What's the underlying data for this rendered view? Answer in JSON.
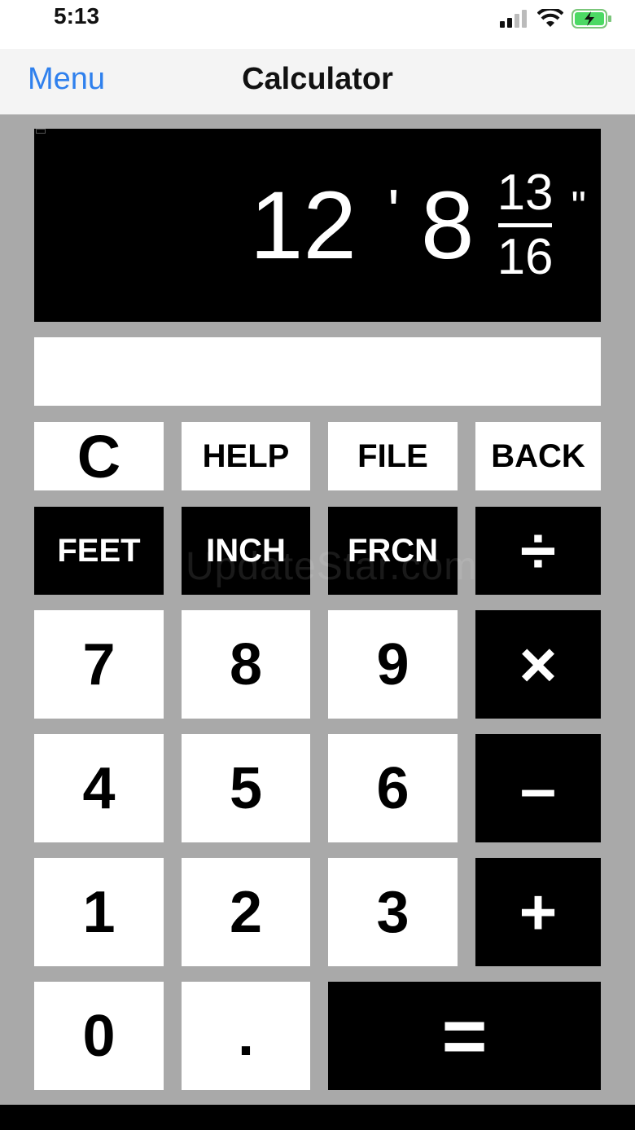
{
  "status": {
    "time": "5:13"
  },
  "nav": {
    "menu": "Menu",
    "title": "Calculator"
  },
  "display": {
    "feet": "12",
    "feet_mark": "'",
    "inches": "8",
    "frac_num": "13",
    "frac_den": "16",
    "inch_mark": "\""
  },
  "entry": {
    "value": ""
  },
  "keys": {
    "clear": "C",
    "help": "HELP",
    "file": "FILE",
    "back": "BACK",
    "feet": "FEET",
    "inch": "INCH",
    "frcn": "FRCN",
    "divide": "÷",
    "d7": "7",
    "d8": "8",
    "d9": "9",
    "multiply": "×",
    "d4": "4",
    "d5": "5",
    "d6": "6",
    "minus": "–",
    "d1": "1",
    "d2": "2",
    "d3": "3",
    "plus": "+",
    "d0": "0",
    "dot": ".",
    "equals": "="
  },
  "watermark": "UpdateStar.com",
  "icons": [
    "signal-icon",
    "wifi-icon",
    "battery-charging-icon"
  ]
}
